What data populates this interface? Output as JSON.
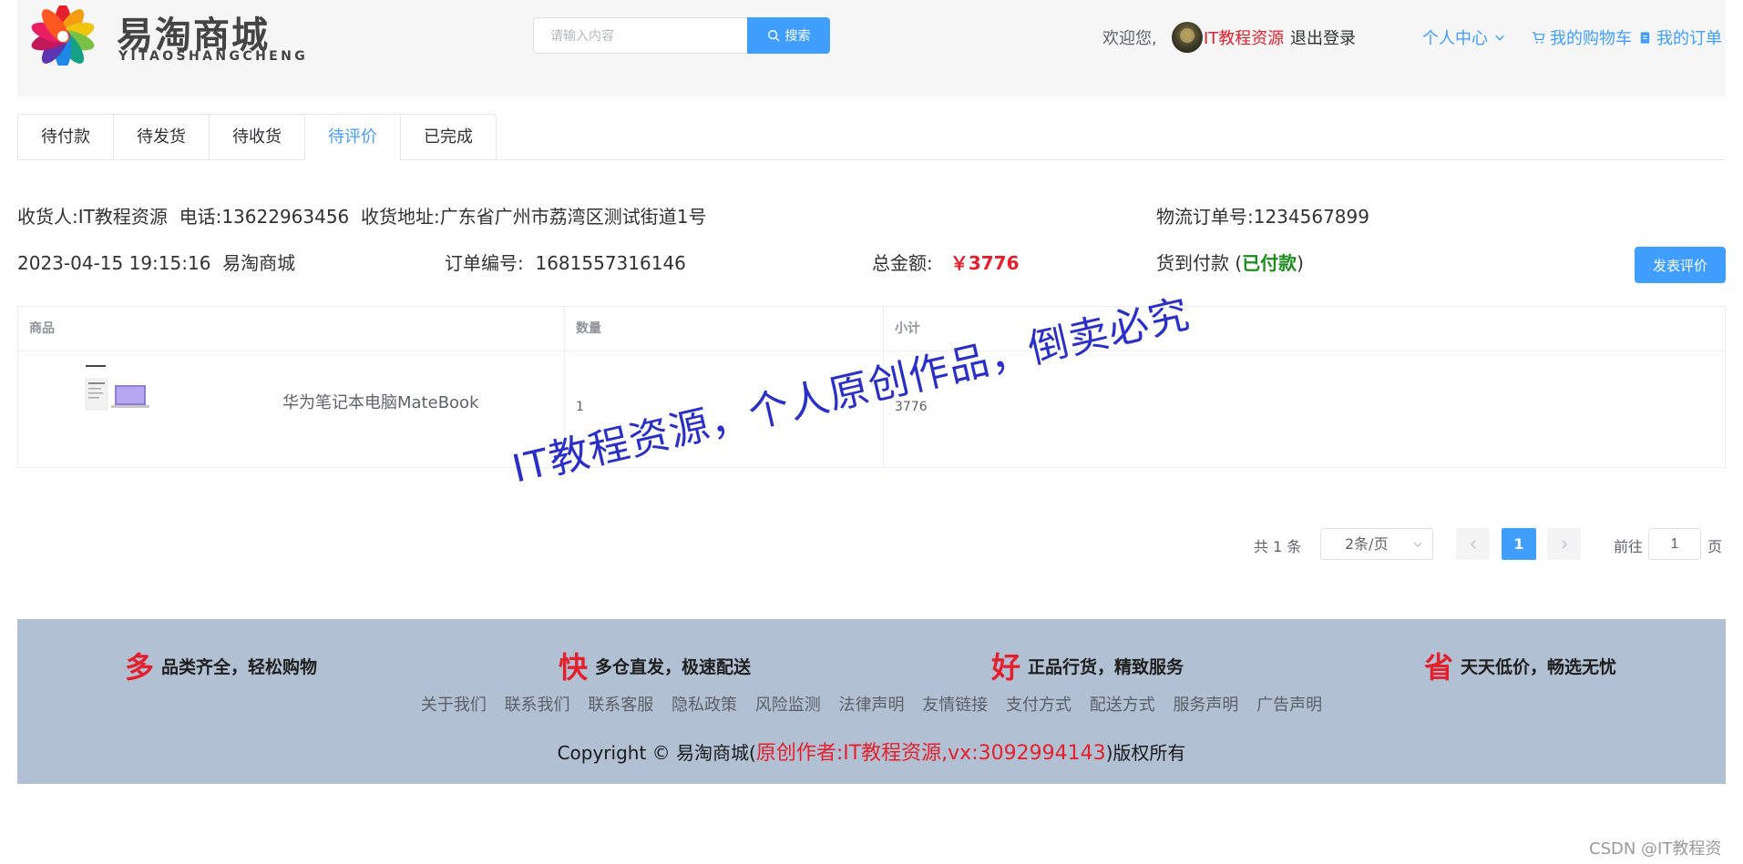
{
  "header": {
    "logo_text": "易淘商城",
    "logo_sub": "YITAOSHANGCHENG",
    "search_placeholder": "请输入内容",
    "search_button": "搜索",
    "welcome": "欢迎您,",
    "username": "IT教程资源",
    "logout": "退出登录",
    "personal_center": "个人中心",
    "cart": "我的购物车",
    "orders": "我的订单"
  },
  "tabs": [
    "待付款",
    "待发货",
    "待收货",
    "待评价",
    "已完成"
  ],
  "active_tab": "待评价",
  "order": {
    "receiver": "收货人:IT教程资源",
    "phone": "电话:13622963456",
    "address": "收货地址:广东省广州市荔湾区测试街道1号",
    "logistics": "物流订单号:1234567899",
    "datetime": "2023-04-15 19:15:16",
    "shop": "易淘商城",
    "order_no_label": "订单编号:",
    "order_no": "1681557316146",
    "total_label": "总金额:",
    "total": "￥3776",
    "payment_method": "货到付款",
    "payment_status": "已付款",
    "review_button": "发表评价"
  },
  "table": {
    "headers": [
      "商品",
      "数量",
      "小计"
    ],
    "rows": [
      {
        "name": "华为笔记本电脑MateBook",
        "quantity": "1",
        "subtotal": "3776"
      }
    ]
  },
  "watermark": "IT教程资源，个人原创作品，倒卖必究",
  "pagination": {
    "total": "共 1 条",
    "page_size": "2条/页",
    "current": "1",
    "goto_label": "前往",
    "goto_value": "1",
    "page_label": "页"
  },
  "footer": {
    "features": [
      {
        "char": "多",
        "text": "品类齐全，轻松购物"
      },
      {
        "char": "快",
        "text": "多仓直发，极速配送"
      },
      {
        "char": "好",
        "text": "正品行货，精致服务"
      },
      {
        "char": "省",
        "text": "天天低价，畅选无忧"
      }
    ],
    "links": [
      "关于我们",
      "联系我们",
      "联系客服",
      "隐私政策",
      "风险监测",
      "法律声明",
      "友情链接",
      "支付方式",
      "配送方式",
      "服务声明",
      "广告声明"
    ],
    "copyright_prefix": "Copyright © 易淘商城(",
    "copyright_red": "原创作者:IT教程资源,vx:3092994143",
    "copyright_suffix": ")版权所有"
  },
  "csdn_mark": "CSDN @IT教程资源-",
  "colors": {
    "primary": "#409eff",
    "accent_red": "#e4202d",
    "paid_green": "#1d8c1d",
    "footer_bg": "#b1c0d2"
  }
}
